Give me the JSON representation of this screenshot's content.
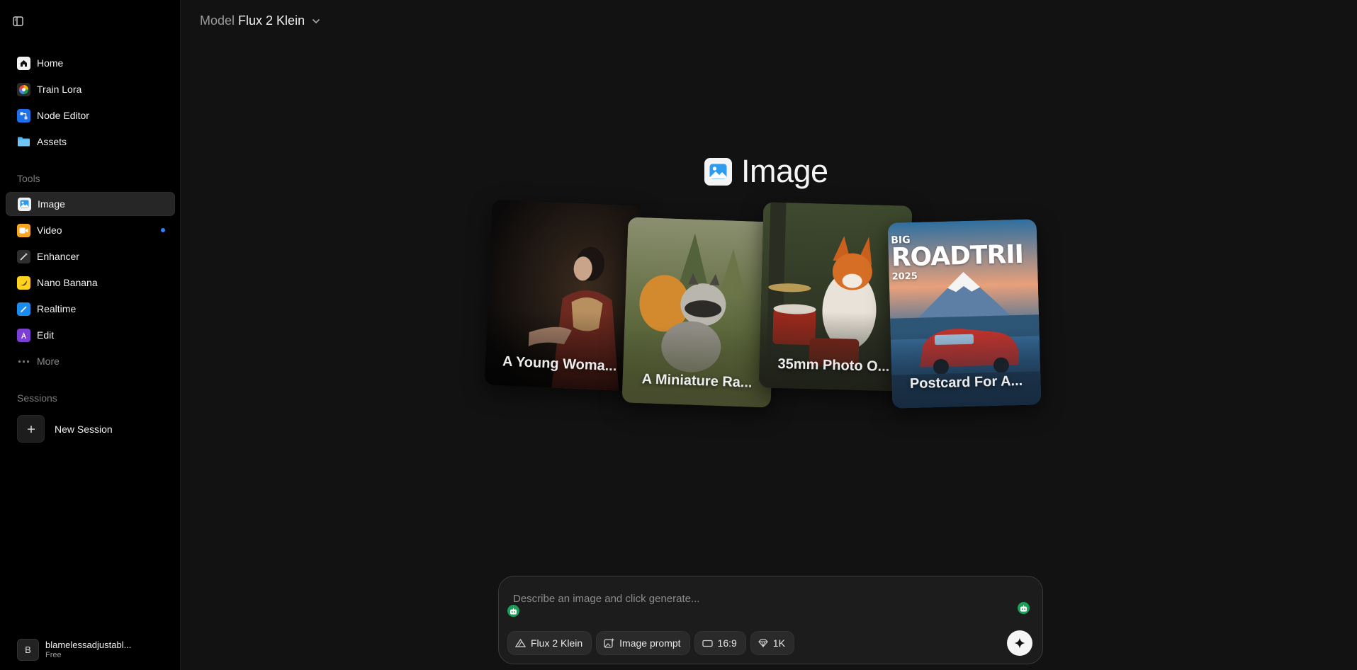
{
  "sidebar": {
    "nav": [
      {
        "label": "Home"
      },
      {
        "label": "Train Lora"
      },
      {
        "label": "Node Editor"
      },
      {
        "label": "Assets"
      }
    ],
    "tools_label": "Tools",
    "tools": [
      {
        "label": "Image",
        "active": true
      },
      {
        "label": "Video",
        "has_dot": true
      },
      {
        "label": "Enhancer"
      },
      {
        "label": "Nano Banana"
      },
      {
        "label": "Realtime"
      },
      {
        "label": "Edit"
      },
      {
        "label": "More"
      }
    ],
    "sessions_label": "Sessions",
    "new_session_label": "New Session",
    "user": {
      "initial": "B",
      "name": "blamelessadjustabl...",
      "plan": "Free"
    }
  },
  "header": {
    "model_label": "Model",
    "model_value": "Flux 2 Klein"
  },
  "hero": {
    "title": "Image",
    "cards": [
      {
        "caption": "A Young Woma..."
      },
      {
        "caption": "A Miniature Ra..."
      },
      {
        "caption": "35mm Photo O..."
      },
      {
        "caption": "Postcard For A...",
        "poster_small": "BIG",
        "poster_big": "ROADTRII",
        "poster_year": "2025"
      }
    ]
  },
  "composer": {
    "placeholder": "Describe an image and click generate...",
    "chips": {
      "model": "Flux 2 Klein",
      "image_prompt": "Image prompt",
      "aspect": "16:9",
      "resolution": "1K"
    }
  },
  "colors": {
    "accent_dot": "#2f80ff",
    "bot_badge": "#19a15a",
    "background": "#121212",
    "sidebar": "#000000"
  }
}
